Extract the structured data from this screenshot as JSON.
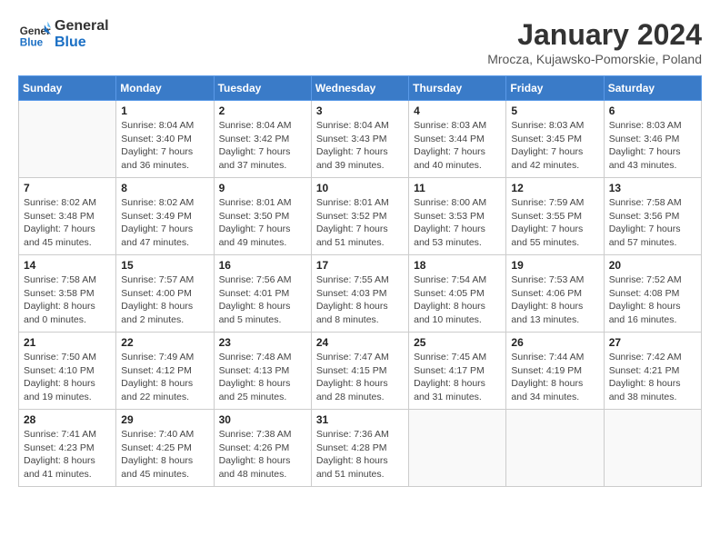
{
  "header": {
    "logo_line1": "General",
    "logo_line2": "Blue",
    "month": "January 2024",
    "location": "Mrocza, Kujawsko-Pomorskie, Poland"
  },
  "weekdays": [
    "Sunday",
    "Monday",
    "Tuesday",
    "Wednesday",
    "Thursday",
    "Friday",
    "Saturday"
  ],
  "weeks": [
    [
      {
        "day": "",
        "info": ""
      },
      {
        "day": "1",
        "info": "Sunrise: 8:04 AM\nSunset: 3:40 PM\nDaylight: 7 hours\nand 36 minutes."
      },
      {
        "day": "2",
        "info": "Sunrise: 8:04 AM\nSunset: 3:42 PM\nDaylight: 7 hours\nand 37 minutes."
      },
      {
        "day": "3",
        "info": "Sunrise: 8:04 AM\nSunset: 3:43 PM\nDaylight: 7 hours\nand 39 minutes."
      },
      {
        "day": "4",
        "info": "Sunrise: 8:03 AM\nSunset: 3:44 PM\nDaylight: 7 hours\nand 40 minutes."
      },
      {
        "day": "5",
        "info": "Sunrise: 8:03 AM\nSunset: 3:45 PM\nDaylight: 7 hours\nand 42 minutes."
      },
      {
        "day": "6",
        "info": "Sunrise: 8:03 AM\nSunset: 3:46 PM\nDaylight: 7 hours\nand 43 minutes."
      }
    ],
    [
      {
        "day": "7",
        "info": "Sunrise: 8:02 AM\nSunset: 3:48 PM\nDaylight: 7 hours\nand 45 minutes."
      },
      {
        "day": "8",
        "info": "Sunrise: 8:02 AM\nSunset: 3:49 PM\nDaylight: 7 hours\nand 47 minutes."
      },
      {
        "day": "9",
        "info": "Sunrise: 8:01 AM\nSunset: 3:50 PM\nDaylight: 7 hours\nand 49 minutes."
      },
      {
        "day": "10",
        "info": "Sunrise: 8:01 AM\nSunset: 3:52 PM\nDaylight: 7 hours\nand 51 minutes."
      },
      {
        "day": "11",
        "info": "Sunrise: 8:00 AM\nSunset: 3:53 PM\nDaylight: 7 hours\nand 53 minutes."
      },
      {
        "day": "12",
        "info": "Sunrise: 7:59 AM\nSunset: 3:55 PM\nDaylight: 7 hours\nand 55 minutes."
      },
      {
        "day": "13",
        "info": "Sunrise: 7:58 AM\nSunset: 3:56 PM\nDaylight: 7 hours\nand 57 minutes."
      }
    ],
    [
      {
        "day": "14",
        "info": "Sunrise: 7:58 AM\nSunset: 3:58 PM\nDaylight: 8 hours\nand 0 minutes."
      },
      {
        "day": "15",
        "info": "Sunrise: 7:57 AM\nSunset: 4:00 PM\nDaylight: 8 hours\nand 2 minutes."
      },
      {
        "day": "16",
        "info": "Sunrise: 7:56 AM\nSunset: 4:01 PM\nDaylight: 8 hours\nand 5 minutes."
      },
      {
        "day": "17",
        "info": "Sunrise: 7:55 AM\nSunset: 4:03 PM\nDaylight: 8 hours\nand 8 minutes."
      },
      {
        "day": "18",
        "info": "Sunrise: 7:54 AM\nSunset: 4:05 PM\nDaylight: 8 hours\nand 10 minutes."
      },
      {
        "day": "19",
        "info": "Sunrise: 7:53 AM\nSunset: 4:06 PM\nDaylight: 8 hours\nand 13 minutes."
      },
      {
        "day": "20",
        "info": "Sunrise: 7:52 AM\nSunset: 4:08 PM\nDaylight: 8 hours\nand 16 minutes."
      }
    ],
    [
      {
        "day": "21",
        "info": "Sunrise: 7:50 AM\nSunset: 4:10 PM\nDaylight: 8 hours\nand 19 minutes."
      },
      {
        "day": "22",
        "info": "Sunrise: 7:49 AM\nSunset: 4:12 PM\nDaylight: 8 hours\nand 22 minutes."
      },
      {
        "day": "23",
        "info": "Sunrise: 7:48 AM\nSunset: 4:13 PM\nDaylight: 8 hours\nand 25 minutes."
      },
      {
        "day": "24",
        "info": "Sunrise: 7:47 AM\nSunset: 4:15 PM\nDaylight: 8 hours\nand 28 minutes."
      },
      {
        "day": "25",
        "info": "Sunrise: 7:45 AM\nSunset: 4:17 PM\nDaylight: 8 hours\nand 31 minutes."
      },
      {
        "day": "26",
        "info": "Sunrise: 7:44 AM\nSunset: 4:19 PM\nDaylight: 8 hours\nand 34 minutes."
      },
      {
        "day": "27",
        "info": "Sunrise: 7:42 AM\nSunset: 4:21 PM\nDaylight: 8 hours\nand 38 minutes."
      }
    ],
    [
      {
        "day": "28",
        "info": "Sunrise: 7:41 AM\nSunset: 4:23 PM\nDaylight: 8 hours\nand 41 minutes."
      },
      {
        "day": "29",
        "info": "Sunrise: 7:40 AM\nSunset: 4:25 PM\nDaylight: 8 hours\nand 45 minutes."
      },
      {
        "day": "30",
        "info": "Sunrise: 7:38 AM\nSunset: 4:26 PM\nDaylight: 8 hours\nand 48 minutes."
      },
      {
        "day": "31",
        "info": "Sunrise: 7:36 AM\nSunset: 4:28 PM\nDaylight: 8 hours\nand 51 minutes."
      },
      {
        "day": "",
        "info": ""
      },
      {
        "day": "",
        "info": ""
      },
      {
        "day": "",
        "info": ""
      }
    ]
  ]
}
